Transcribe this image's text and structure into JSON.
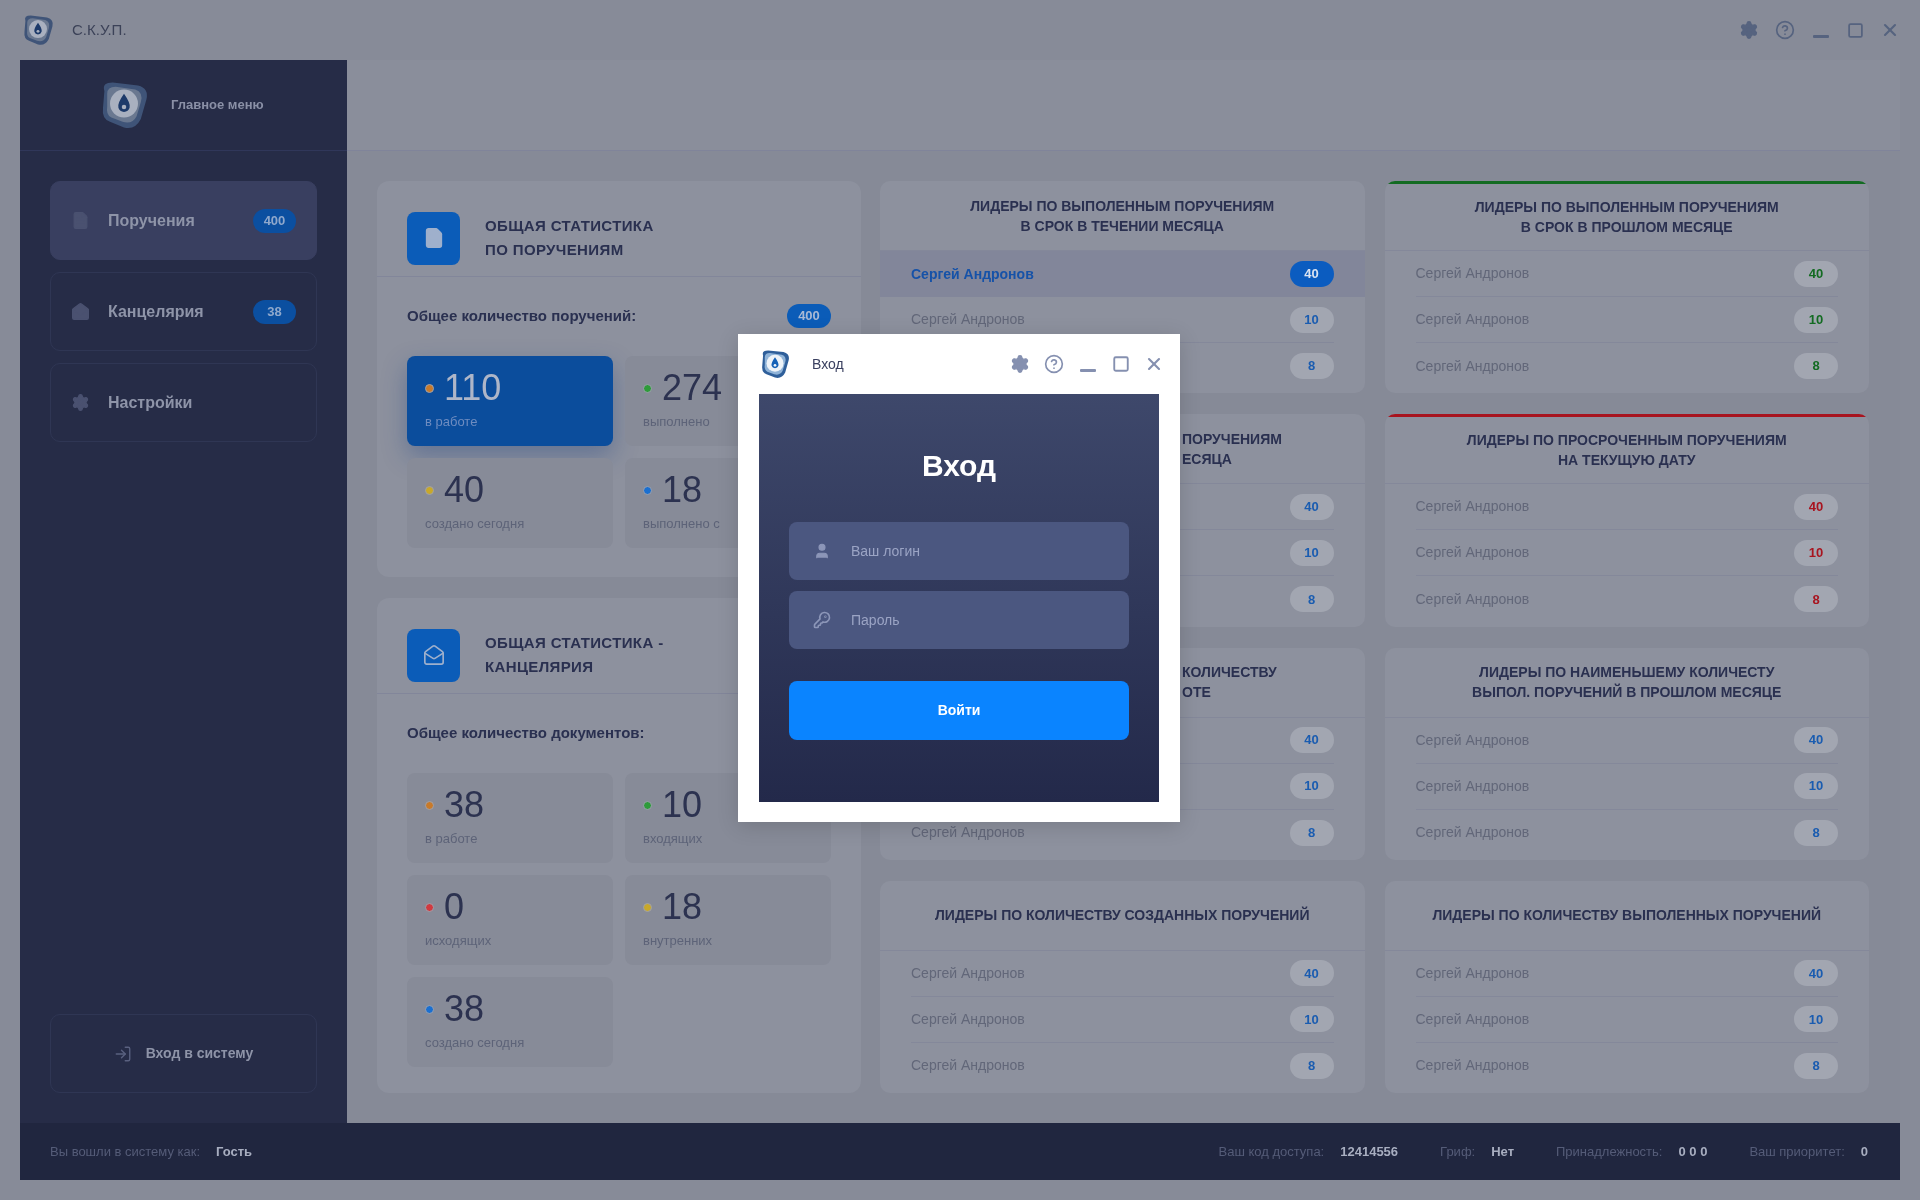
{
  "app": {
    "title": "С.К.У.П."
  },
  "sidebar": {
    "header": "Главное меню",
    "items": [
      {
        "label": "Поручения",
        "badge": "400",
        "selected": true
      },
      {
        "label": "Канцелярия",
        "badge": "38",
        "selected": false
      },
      {
        "label": "Настройки",
        "selected": false
      }
    ],
    "login_button": "Вход в систему"
  },
  "stats": [
    {
      "title_lines": [
        "ОБЩАЯ СТАТИСТИКА",
        "ПО ПОРУЧЕНИЯМ"
      ],
      "total_label": "Общее количество поручений:",
      "total": "400",
      "tiles": [
        {
          "value": "110",
          "label": "в работе",
          "color": "#c87a2a",
          "selected": true
        },
        {
          "value": "274",
          "label": "выполнено",
          "color": "#2e9b3a",
          "selected": false
        },
        {
          "value": "40",
          "label": "создано сегодня",
          "color": "#c8a82a",
          "selected": false
        },
        {
          "value": "18",
          "label": "выполнено с",
          "color": "#1a6fd0",
          "selected": false
        }
      ]
    },
    {
      "title_lines": [
        "ОБЩАЯ СТАТИСТИКА -",
        "КАНЦЕЛЯРИЯ"
      ],
      "total_label": "Общее количество документов:",
      "tiles": [
        {
          "value": "38",
          "label": "в работе",
          "color": "#c87a2a",
          "selected": false
        },
        {
          "value": "10",
          "label": "входящих",
          "color": "#2e9b3a",
          "selected": false
        },
        {
          "value": "0",
          "label": "исходящих",
          "color": "#d03a40",
          "selected": false
        },
        {
          "value": "18",
          "label": "внутренних",
          "color": "#c8a82a",
          "selected": false
        },
        {
          "value": "38",
          "label": "создано сегодня",
          "color": "#1a6fd0",
          "selected": false
        }
      ]
    }
  ],
  "leaders": [
    {
      "kind": "plain",
      "color": "#1a5cb0",
      "title_lines": [
        "ЛИДЕРЫ ПО ВЫПОЛЕННЫМ ПОРУЧЕНИЯМ",
        "В СРОК В ТЕЧЕНИИ МЕСЯЦА"
      ],
      "rows": [
        {
          "name": "Сергей Андронов",
          "value": "40",
          "selected": true
        },
        {
          "name": "Сергей Андронов",
          "value": "10",
          "selected": false
        },
        {
          "value": "8",
          "selected": false
        }
      ]
    },
    {
      "kind": "accented",
      "color": "#136b22",
      "title_lines": [
        "ЛИДЕРЫ ПО ВЫПОЛЕННЫМ ПОРУЧЕНИЯМ",
        "В СРОК В ПРОШЛОМ МЕСЯЦЕ"
      ],
      "rows": [
        {
          "name": "Сергей Андронов",
          "value": "40",
          "selected": false
        },
        {
          "name": "Сергей Андронов",
          "value": "10",
          "selected": false
        },
        {
          "name": "Сергей Андронов",
          "value": "8",
          "selected": false
        }
      ]
    },
    {
      "kind": "covered",
      "color": "#1a5cb0",
      "title_lines": [
        "ПОРУЧЕНИЯМ",
        "ЕСЯЦА"
      ],
      "rows": [
        {
          "value": "40",
          "selected": false
        },
        {
          "value": "10",
          "selected": false
        },
        {
          "value": "8",
          "selected": false
        }
      ]
    },
    {
      "kind": "accented",
      "color": "#a8141f",
      "title_lines": [
        "ЛИДЕРЫ ПО ПРОСРОЧЕННЫМ ПОРУЧЕНИЯМ",
        "НА ТЕКУЩУЮ ДАТУ"
      ],
      "rows": [
        {
          "name": "Сергей Андронов",
          "value": "40",
          "selected": false
        },
        {
          "name": "Сергей Андронов",
          "value": "10",
          "selected": false
        },
        {
          "name": "Сергей Андронов",
          "value": "8",
          "selected": false
        }
      ]
    },
    {
      "kind": "covered",
      "color": "#1a5cb0",
      "title_lines": [
        "КОЛИЧЕСТВУ",
        "ОТЕ"
      ],
      "rows": [
        {
          "value": "40",
          "selected": false
        },
        {
          "value": "10",
          "selected": false
        },
        {
          "name": "Сергей Андронов",
          "value": "8",
          "selected": false
        }
      ]
    },
    {
      "kind": "plain",
      "color": "#1a5cb0",
      "title_lines": [
        "ЛИДЕРЫ ПО НАИМЕНЬШЕМУ КОЛИЧЕСТУ",
        "ВЫПОЛ. ПОРУЧЕНИЙ В ПРОШЛОМ МЕСЯЦЕ"
      ],
      "rows": [
        {
          "name": "Сергей Андронов",
          "value": "40",
          "selected": false
        },
        {
          "name": "Сергей Андронов",
          "value": "10",
          "selected": false
        },
        {
          "name": "Сергей Андронов",
          "value": "8",
          "selected": false
        }
      ]
    },
    {
      "kind": "plain",
      "color": "#1a5cb0",
      "title_lines": [
        "ЛИДЕРЫ ПО КОЛИЧЕСТВУ СОЗДАННЫХ ПОРУЧЕНИЙ"
      ],
      "rows": [
        {
          "name": "Сергей Андронов",
          "value": "40",
          "selected": false
        },
        {
          "name": "Сергей Андронов",
          "value": "10",
          "selected": false
        },
        {
          "name": "Сергей Андронов",
          "value": "8",
          "selected": false
        }
      ]
    },
    {
      "kind": "plain",
      "color": "#1a5cb0",
      "title_lines": [
        "ЛИДЕРЫ ПО КОЛИЧЕСТВУ ВЫПОЛЕННЫХ ПОРУЧЕНИЙ"
      ],
      "rows": [
        {
          "name": "Сергей Андронов",
          "value": "40",
          "selected": false
        },
        {
          "name": "Сергей Андронов",
          "value": "10",
          "selected": false
        },
        {
          "name": "Сергей Андронов",
          "value": "8",
          "selected": false
        }
      ]
    }
  ],
  "status_bar": {
    "user_label": "Вы вошли в систему как:",
    "user": "Гость",
    "fields": [
      {
        "label": "Ваш код доступа:",
        "value": "12414556"
      },
      {
        "label": "Гриф:",
        "value": "Нет"
      },
      {
        "label": "Принадлежность:",
        "value": "0 0 0"
      },
      {
        "label": "Ваш приоритет:",
        "value": "0"
      }
    ]
  },
  "login_dialog": {
    "title": "Вход",
    "heading": "Вход",
    "login_placeholder": "Ваш логин",
    "password_placeholder": "Пароль",
    "submit": "Войти"
  }
}
